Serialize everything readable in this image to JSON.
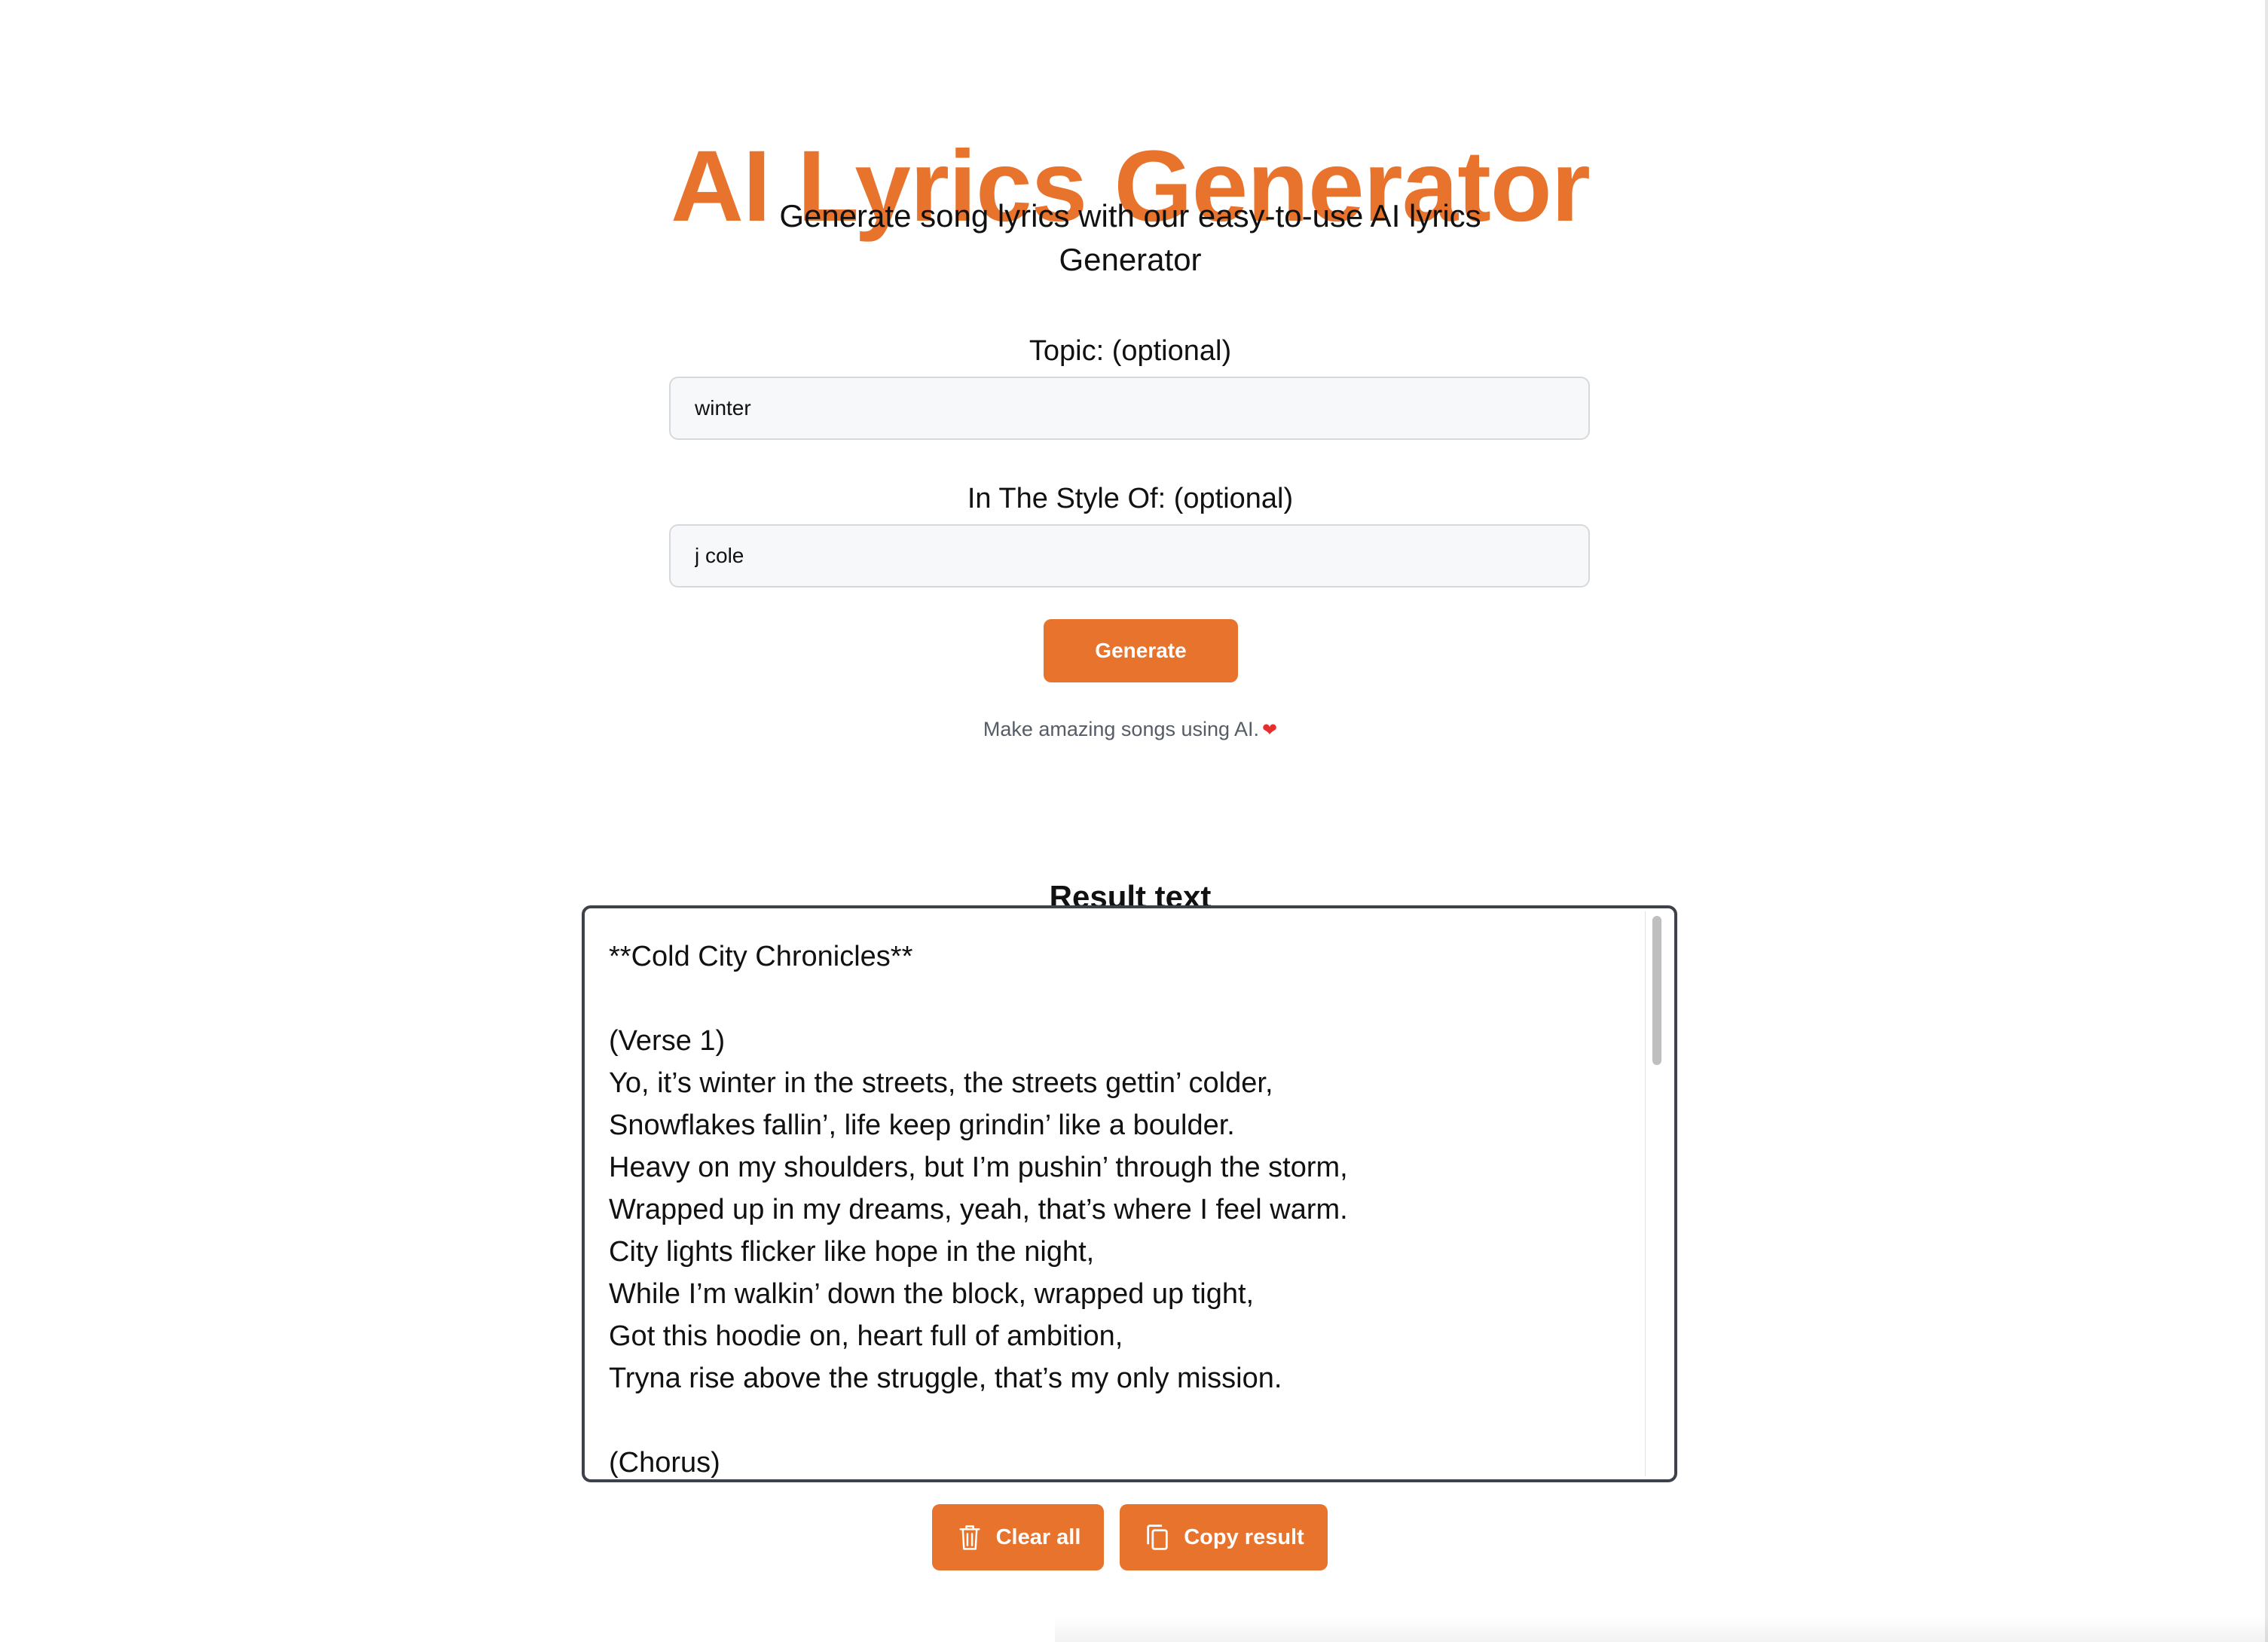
{
  "header": {
    "title": "AI Lyrics Generator",
    "subtitle": "Generate song lyrics with our easy-to-use AI lyrics Generator"
  },
  "form": {
    "topic": {
      "label": "Topic: (optional)",
      "value": "winter"
    },
    "style": {
      "label": "In The Style Of: (optional)",
      "value": "j cole"
    },
    "generate_label": "Generate",
    "tagline": "Make amazing songs using AI.",
    "tagline_icon": "heart-icon"
  },
  "result": {
    "heading": "Result text",
    "lines": [
      "**Cold City Chronicles**",
      "",
      "(Verse 1)",
      "Yo, it’s winter in the streets, the streets gettin’ colder,",
      "Snowflakes fallin’, life keep grindin’ like a boulder.",
      "Heavy on my shoulders, but I’m pushin’ through the storm,",
      "Wrapped up in my dreams, yeah, that’s where I feel warm.",
      "City lights flicker like hope in the night,",
      "While I’m walkin’ down the block, wrapped up tight,",
      "Got this hoodie on, heart full of ambition,",
      "Tryna rise above the struggle, that’s my only mission.",
      "",
      "(Chorus)"
    ]
  },
  "actions": {
    "clear_label": "Clear all",
    "clear_icon": "trash-icon",
    "copy_label": "Copy result",
    "copy_icon": "copy-icon"
  },
  "colors": {
    "accent": "#e8732c",
    "heart": "#e62e2e",
    "border": "#3d4149"
  }
}
